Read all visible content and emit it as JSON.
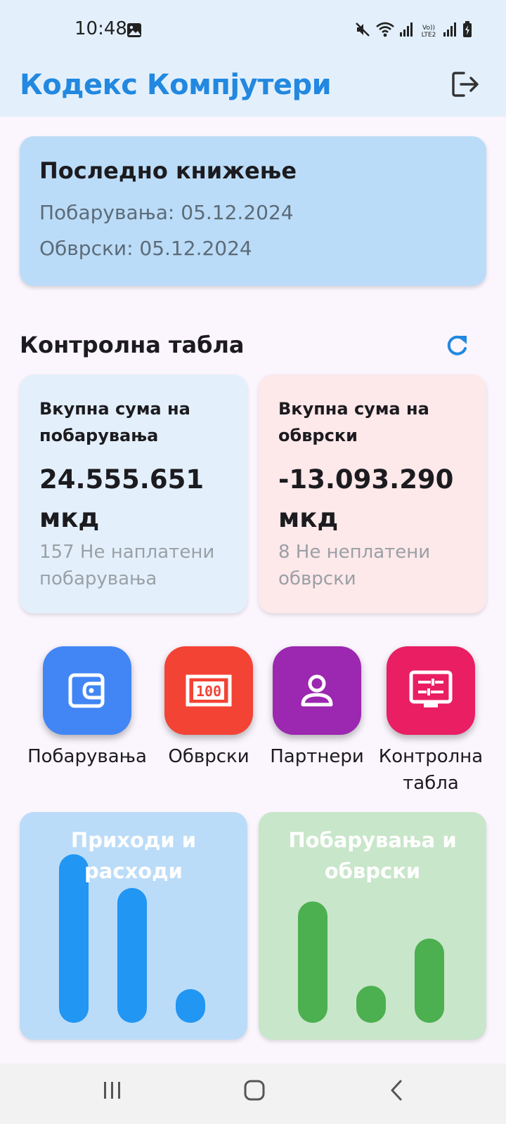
{
  "status_bar": {
    "time": "10:48",
    "icons": [
      "image-icon",
      "mute-icon",
      "wifi-icon",
      "signal-icon",
      "volte-icon",
      "signal-icon",
      "battery-icon"
    ],
    "volte_label": "Vo)) LTE2"
  },
  "app_bar": {
    "title": "Кодекс Компјутери",
    "logout_icon": "logout-icon"
  },
  "last_posting": {
    "title": "Последно книжење",
    "receivables": "Побарувања: 05.12.2024",
    "liabilities": "Обврски: 05.12.2024"
  },
  "dashboard": {
    "title": "Контролна табла",
    "refresh_icon": "refresh-icon",
    "receivables_card": {
      "label": "Вкупна сума на побарувања",
      "amount": "24.555.651 мкд",
      "subtitle": "157 Не наплатени побарувања"
    },
    "liabilities_card": {
      "label": "Вкупна сума на обврски",
      "amount": "-13.093.290 мкд",
      "subtitle": "8 Не неплатени обврски"
    }
  },
  "actions": [
    {
      "label": "Побарувања",
      "icon": "wallet-icon",
      "color": "#4286f5"
    },
    {
      "label": "Обврски",
      "icon": "banknote-icon",
      "color": "#f34335"
    },
    {
      "label": "Партнери",
      "icon": "person-icon",
      "color": "#9c27b0"
    },
    {
      "label": "Контролна табла",
      "icon": "dashboard-monitor-icon",
      "color": "#e91e63"
    }
  ],
  "charts": [
    {
      "title": "Приходи и расходи",
      "bar_color": "#2196f3",
      "bg_color": "#bbdcf8",
      "values": [
        1.0,
        0.8,
        0.2
      ]
    },
    {
      "title": "Побарувања и обврски",
      "bar_color": "#4caf50",
      "bg_color": "#c8e6c9",
      "values": [
        0.72,
        0.22,
        0.5
      ]
    }
  ],
  "nav": {
    "items": [
      "recent-apps-icon",
      "home-icon",
      "back-icon"
    ]
  }
}
